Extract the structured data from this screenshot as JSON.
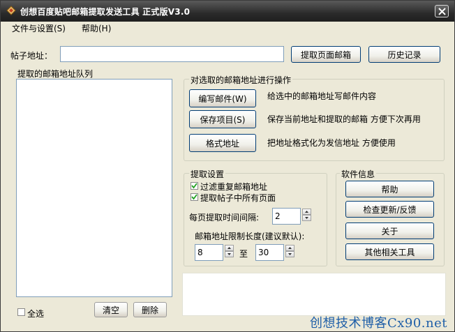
{
  "window": {
    "title": "创想百度贴吧邮箱提取发送工具  正式版V3.0"
  },
  "menu": {
    "file": "文件与设置(S)",
    "help": "帮助(H)"
  },
  "post_url": {
    "label": "帖子地址：",
    "value": "",
    "extract_button": "提取页面邮箱",
    "history_button": "历史记录"
  },
  "queue": {
    "title": "提取的邮箱地址队列",
    "select_all": "全选",
    "select_all_checked": false,
    "clear_button": "清空",
    "delete_button": "删除"
  },
  "operations": {
    "title": "对选取的邮箱地址进行操作",
    "items": [
      {
        "button": "编写邮件(W)",
        "desc": "给选中的邮箱地址写邮件内容"
      },
      {
        "button": "保存项目(S)",
        "desc": "保存当前地址和提取的邮箱 方便下次再用"
      },
      {
        "button": "格式地址",
        "desc": "把地址格式化为发信地址 方便使用"
      }
    ]
  },
  "extract_settings": {
    "title": "提取设置",
    "filter_duplicates": "过滤重复邮箱地址",
    "filter_duplicates_checked": true,
    "all_pages": "提取帖子中所有页面",
    "all_pages_checked": true,
    "interval_label": "每页提取时间间隔:",
    "interval_value": "2",
    "length_label": "邮箱地址限制长度(建议默认):",
    "length_min": "8",
    "to_label": "至",
    "length_max": "30"
  },
  "software_info": {
    "title": "软件信息",
    "buttons": [
      "帮助",
      "检查更新/反馈",
      "关于",
      "其他相关工具"
    ]
  },
  "watermark": "创想技术博客Cx90.net"
}
